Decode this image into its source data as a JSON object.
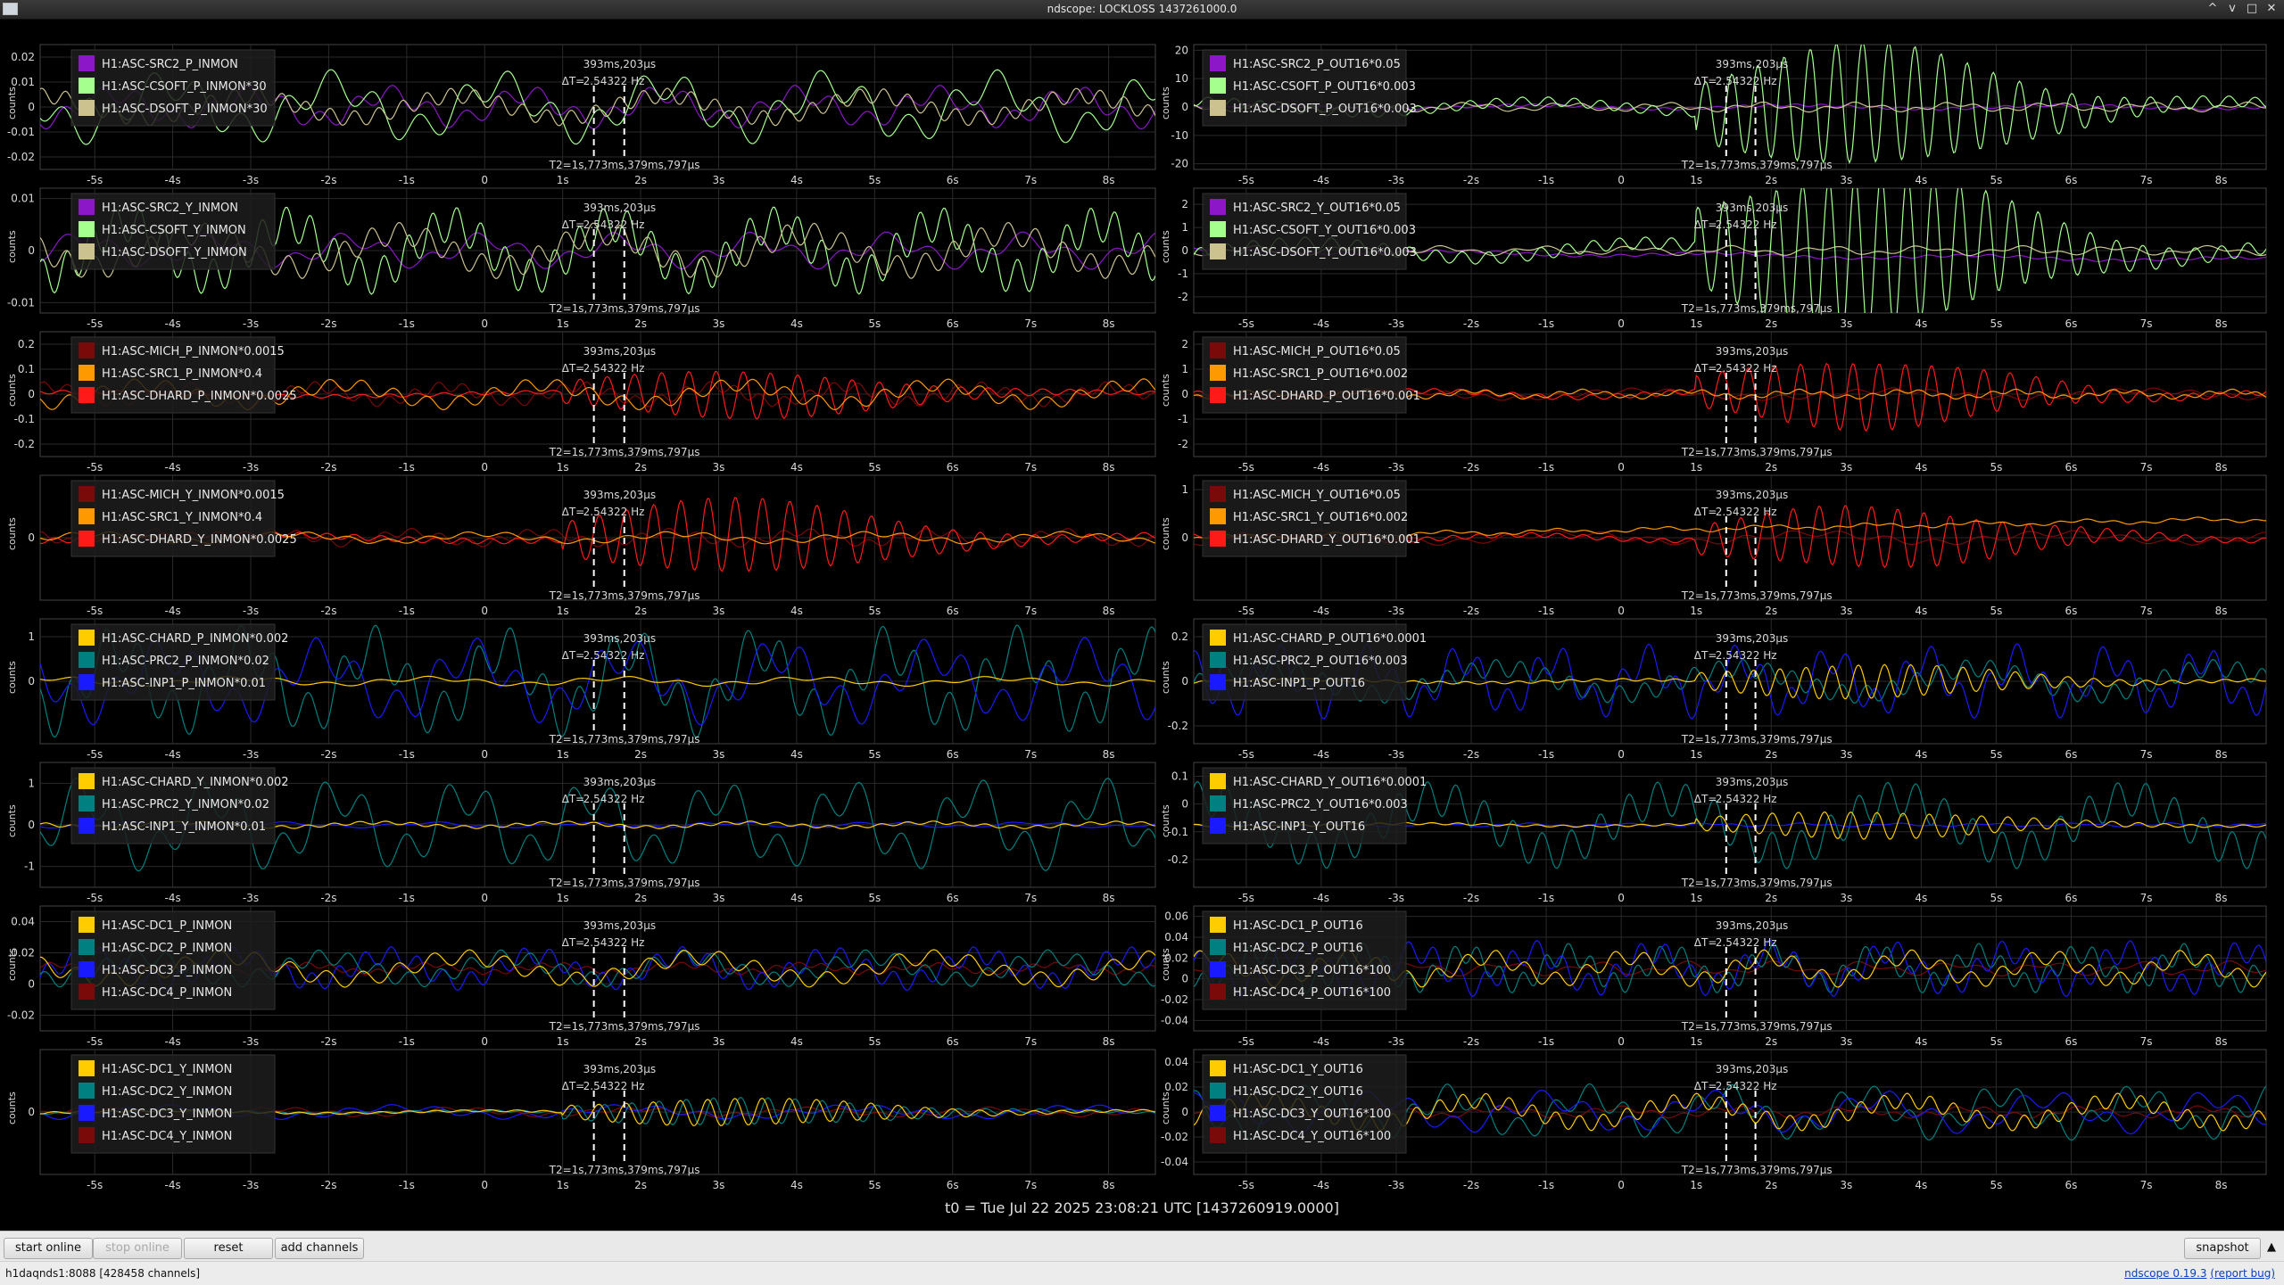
{
  "window": {
    "title": "ndscope: LOCKLOSS 1437261000.0",
    "controls": [
      "^",
      "v",
      "□",
      "✕"
    ]
  },
  "theme": {
    "grid": "#2a2a2a",
    "axis_text": "#d8d8d8",
    "legend_bg": "#1d1d1d",
    "cursor_color": "#ffffff"
  },
  "common": {
    "ylabel": "counts",
    "cursor": {
      "delta_label": "ΔT=",
      "delta_value": "393ms,203μs",
      "freq": "2.54322 Hz",
      "t2_label": "T2=1s,773ms,379ms,797μs"
    }
  },
  "plots": [
    {
      "column": "left",
      "ylim": [
        -0.025,
        0.025
      ],
      "yticks": [
        "0.02",
        "0.01",
        "0",
        "-0.01",
        "-0.02"
      ],
      "xticks": [
        "-5s",
        "-4s",
        "-3s",
        "-2s",
        "-1s",
        "0",
        "1s",
        "2s",
        "3s",
        "4s",
        "5s",
        "6s",
        "7s",
        "8s"
      ],
      "xlim": [
        -5.7,
        8.6
      ],
      "legend": [
        {
          "name": "H1:ASC-SRC2_P_INMON",
          "color": "#8b17c9"
        },
        {
          "name": "H1:ASC-CSOFT_P_INMON*30",
          "color": "#a4ff8f"
        },
        {
          "name": "H1:ASC-DSOFT_P_INMON*30",
          "color": "#cbc28f"
        }
      ],
      "series": [
        {
          "color": "#8b17c9",
          "amp": 0.35,
          "seed": 1
        },
        {
          "color": "#a4ff8f",
          "amp": 0.6,
          "seed": 2
        },
        {
          "color": "#cbc28f",
          "amp": 0.3,
          "seed": 3
        }
      ]
    },
    {
      "column": "right",
      "ylim": [
        -22,
        22
      ],
      "yticks": [
        "20",
        "10",
        "0",
        "-10",
        "-20"
      ],
      "xticks": [
        "-5s",
        "-4s",
        "-3s",
        "-2s",
        "-1s",
        "0",
        "1s",
        "2s",
        "3s",
        "4s",
        "5s",
        "6s",
        "7s",
        "8s"
      ],
      "xlim": [
        -5.7,
        8.6
      ],
      "legend": [
        {
          "name": "H1:ASC-SRC2_P_OUT16*0.05",
          "color": "#8b17c9"
        },
        {
          "name": "H1:ASC-CSOFT_P_OUT16*0.003",
          "color": "#a4ff8f"
        },
        {
          "name": "H1:ASC-DSOFT_P_OUT16*0.003",
          "color": "#cbc28f"
        }
      ],
      "series": [
        {
          "color": "#8b17c9",
          "amp": 0.05,
          "seed": 4
        },
        {
          "color": "#cbc28f",
          "amp": 0.08,
          "seed": 5
        },
        {
          "color": "#a4ff8f",
          "amp": 0.9,
          "seed": 6,
          "burst": true
        }
      ]
    },
    {
      "column": "left",
      "ylim": [
        -0.012,
        0.012
      ],
      "yticks": [
        "0.01",
        "0",
        "-0.01"
      ],
      "xticks": [
        "-5s",
        "-4s",
        "-3s",
        "-2s",
        "-1s",
        "0",
        "1s",
        "2s",
        "3s",
        "4s",
        "5s",
        "6s",
        "7s",
        "8s"
      ],
      "xlim": [
        -5.7,
        8.6
      ],
      "legend": [
        {
          "name": "H1:ASC-SRC2_Y_INMON",
          "color": "#8b17c9"
        },
        {
          "name": "H1:ASC-CSOFT_Y_INMON",
          "color": "#a4ff8f"
        },
        {
          "name": "H1:ASC-DSOFT_Y_INMON",
          "color": "#cbc28f"
        }
      ],
      "series": [
        {
          "color": "#8b17c9",
          "amp": 0.3,
          "seed": 7
        },
        {
          "color": "#a4ff8f",
          "amp": 0.7,
          "seed": 8
        },
        {
          "color": "#cbc28f",
          "amp": 0.45,
          "seed": 9
        }
      ]
    },
    {
      "column": "right",
      "ylim": [
        -2.7,
        2.7
      ],
      "yticks": [
        "2",
        "1",
        "0",
        "-1",
        "-2"
      ],
      "xticks": [
        "-5s",
        "-4s",
        "-3s",
        "-2s",
        "-1s",
        "0",
        "1s",
        "2s",
        "3s",
        "4s",
        "5s",
        "6s",
        "7s",
        "8s"
      ],
      "xlim": [
        -5.7,
        8.6
      ],
      "legend": [
        {
          "name": "H1:ASC-SRC2_Y_OUT16*0.05",
          "color": "#8b17c9"
        },
        {
          "name": "H1:ASC-CSOFT_Y_OUT16*0.003",
          "color": "#a4ff8f"
        },
        {
          "name": "H1:ASC-DSOFT_Y_OUT16*0.003",
          "color": "#cbc28f"
        }
      ],
      "series": [
        {
          "color": "#8b17c9",
          "amp": 0.05,
          "seed": 10,
          "drift": -0.15
        },
        {
          "color": "#cbc28f",
          "amp": 0.08,
          "seed": 11
        },
        {
          "color": "#a4ff8f",
          "amp": 1.2,
          "seed": 12,
          "burst": true
        }
      ]
    },
    {
      "column": "left",
      "ylim": [
        -0.25,
        0.25
      ],
      "yticks": [
        "0.2",
        "0.1",
        "0",
        "-0.1",
        "-0.2"
      ],
      "xticks": [
        "-5s",
        "-4s",
        "-3s",
        "-2s",
        "-1s",
        "0",
        "1s",
        "2s",
        "3s",
        "4s",
        "5s",
        "6s",
        "7s",
        "8s"
      ],
      "xlim": [
        -5.7,
        8.6
      ],
      "legend": [
        {
          "name": "H1:ASC-MICH_P_INMON*0.0015",
          "color": "#7a0a0a"
        },
        {
          "name": "H1:ASC-SRC1_P_INMON*0.4",
          "color": "#ff9900"
        },
        {
          "name": "H1:ASC-DHARD_P_INMON*0.0025",
          "color": "#ff1a1a"
        }
      ],
      "series": [
        {
          "color": "#7a0a0a",
          "amp": 0.2,
          "seed": 13
        },
        {
          "color": "#ff1a1a",
          "amp": 0.35,
          "seed": 14,
          "burst": true
        },
        {
          "color": "#ff9900",
          "amp": 0.25,
          "seed": 15
        }
      ]
    },
    {
      "column": "right",
      "ylim": [
        -2.5,
        2.5
      ],
      "yticks": [
        "2",
        "1",
        "0",
        "-1",
        "-2"
      ],
      "xticks": [
        "-5s",
        "-4s",
        "-3s",
        "-2s",
        "-1s",
        "0",
        "1s",
        "2s",
        "3s",
        "4s",
        "5s",
        "6s",
        "7s",
        "8s"
      ],
      "xlim": [
        -5.7,
        8.6
      ],
      "legend": [
        {
          "name": "H1:ASC-MICH_P_OUT16*0.05",
          "color": "#7a0a0a"
        },
        {
          "name": "H1:ASC-SRC1_P_OUT16*0.002",
          "color": "#ff9900"
        },
        {
          "name": "H1:ASC-DHARD_P_OUT16*0.001",
          "color": "#ff1a1a"
        }
      ],
      "series": [
        {
          "color": "#7a0a0a",
          "amp": 0.1,
          "seed": 16
        },
        {
          "color": "#ff1a1a",
          "amp": 0.5,
          "seed": 17,
          "burst": true
        },
        {
          "color": "#ff9900",
          "amp": 0.08,
          "seed": 18
        }
      ]
    },
    {
      "column": "left",
      "ylim": [
        -0.3,
        0.3
      ],
      "yticks": [
        "0"
      ],
      "xticks": [
        "-5s",
        "-4s",
        "-3s",
        "-2s",
        "-1s",
        "0",
        "1s",
        "2s",
        "3s",
        "4s",
        "5s",
        "6s",
        "7s",
        "8s"
      ],
      "xlim": [
        -5.7,
        8.6
      ],
      "legend": [
        {
          "name": "H1:ASC-MICH_Y_INMON*0.0015",
          "color": "#7a0a0a"
        },
        {
          "name": "H1:ASC-SRC1_Y_INMON*0.4",
          "color": "#ff9900"
        },
        {
          "name": "H1:ASC-DHARD_Y_INMON*0.0025",
          "color": "#ff1a1a"
        }
      ],
      "series": [
        {
          "color": "#7a0a0a",
          "amp": 0.15,
          "seed": 19
        },
        {
          "color": "#ff1a1a",
          "amp": 0.55,
          "seed": 20,
          "burst": true
        },
        {
          "color": "#ff9900",
          "amp": 0.1,
          "seed": 21
        }
      ]
    },
    {
      "column": "right",
      "ylim": [
        -1.3,
        1.3
      ],
      "yticks": [
        "1",
        "0"
      ],
      "xticks": [
        "-5s",
        "-4s",
        "-3s",
        "-2s",
        "-1s",
        "0",
        "1s",
        "2s",
        "3s",
        "4s",
        "5s",
        "6s",
        "7s",
        "8s"
      ],
      "xlim": [
        -5.7,
        8.6
      ],
      "legend": [
        {
          "name": "H1:ASC-MICH_Y_OUT16*0.05",
          "color": "#7a0a0a"
        },
        {
          "name": "H1:ASC-SRC1_Y_OUT16*0.002",
          "color": "#ff9900"
        },
        {
          "name": "H1:ASC-DHARD_Y_OUT16*0.001",
          "color": "#ff1a1a"
        }
      ],
      "series": [
        {
          "color": "#7a0a0a",
          "amp": 0.12,
          "seed": 22
        },
        {
          "color": "#ff1a1a",
          "amp": 0.45,
          "seed": 23,
          "burst": true
        },
        {
          "color": "#ff9900",
          "amp": 0.05,
          "seed": 24,
          "drift": 0.3
        }
      ]
    },
    {
      "column": "left",
      "ylim": [
        -1.4,
        1.4
      ],
      "yticks": [
        "1",
        "0"
      ],
      "xticks": [
        "-5s",
        "-4s",
        "-3s",
        "-2s",
        "-1s",
        "0",
        "1s",
        "2s",
        "3s",
        "4s",
        "5s",
        "6s",
        "7s",
        "8s"
      ],
      "xlim": [
        -5.7,
        8.6
      ],
      "legend": [
        {
          "name": "H1:ASC-CHARD_P_INMON*0.002",
          "color": "#ffcc00"
        },
        {
          "name": "H1:ASC-PRC2_P_INMON*0.02",
          "color": "#008080"
        },
        {
          "name": "H1:ASC-INP1_P_INMON*0.01",
          "color": "#1a1aff"
        }
      ],
      "series": [
        {
          "color": "#008080",
          "amp": 0.9,
          "seed": 25
        },
        {
          "color": "#1a1aff",
          "amp": 0.7,
          "seed": 26
        },
        {
          "color": "#ffcc00",
          "amp": 0.08,
          "seed": 27
        }
      ]
    },
    {
      "column": "right",
      "ylim": [
        -0.28,
        0.28
      ],
      "yticks": [
        "0.2",
        "0",
        "-0.2"
      ],
      "xticks": [
        "-5s",
        "-4s",
        "-3s",
        "-2s",
        "-1s",
        "0",
        "1s",
        "2s",
        "3s",
        "4s",
        "5s",
        "6s",
        "7s",
        "8s"
      ],
      "xlim": [
        -5.7,
        8.6
      ],
      "legend": [
        {
          "name": "H1:ASC-CHARD_P_OUT16*0.0001",
          "color": "#ffcc00"
        },
        {
          "name": "H1:ASC-PRC2_P_OUT16*0.003",
          "color": "#008080"
        },
        {
          "name": "H1:ASC-INP1_P_OUT16",
          "color": "#1a1aff"
        }
      ],
      "series": [
        {
          "color": "#008080",
          "amp": 0.35,
          "seed": 28
        },
        {
          "color": "#1a1aff",
          "amp": 0.6,
          "seed": 29
        },
        {
          "color": "#ffcc00",
          "amp": 0.25,
          "seed": 30,
          "burst": true
        }
      ]
    },
    {
      "column": "left",
      "ylim": [
        -1.5,
        1.5
      ],
      "yticks": [
        "1",
        "0",
        "-1"
      ],
      "xticks": [
        "-5s",
        "-4s",
        "-3s",
        "-2s",
        "-1s",
        "0",
        "1s",
        "2s",
        "3s",
        "4s",
        "5s",
        "6s",
        "7s",
        "8s"
      ],
      "xlim": [
        -5.7,
        8.6
      ],
      "legend": [
        {
          "name": "H1:ASC-CHARD_Y_INMON*0.002",
          "color": "#ffcc00"
        },
        {
          "name": "H1:ASC-PRC2_Y_INMON*0.02",
          "color": "#008080"
        },
        {
          "name": "H1:ASC-INP1_Y_INMON*0.01",
          "color": "#1a1aff"
        }
      ],
      "series": [
        {
          "color": "#008080",
          "amp": 0.8,
          "seed": 31
        },
        {
          "color": "#1a1aff",
          "amp": 0.05,
          "seed": 32
        },
        {
          "color": "#ffcc00",
          "amp": 0.06,
          "seed": 33
        }
      ]
    },
    {
      "column": "right",
      "ylim": [
        -0.3,
        0.15
      ],
      "yticks": [
        "0.1",
        "0",
        "-0.1",
        "-0.2"
      ],
      "xticks": [
        "-5s",
        "-4s",
        "-3s",
        "-2s",
        "-1s",
        "0",
        "1s",
        "2s",
        "3s",
        "4s",
        "5s",
        "6s",
        "7s",
        "8s"
      ],
      "xlim": [
        -5.7,
        8.6
      ],
      "legend": [
        {
          "name": "H1:ASC-CHARD_Y_OUT16*0.0001",
          "color": "#ffcc00"
        },
        {
          "name": "H1:ASC-PRC2_Y_OUT16*0.003",
          "color": "#008080"
        },
        {
          "name": "H1:ASC-INP1_Y_OUT16",
          "color": "#1a1aff"
        }
      ],
      "series": [
        {
          "color": "#008080",
          "amp": 0.7,
          "seed": 34
        },
        {
          "color": "#1a1aff",
          "amp": 0.03,
          "seed": 35
        },
        {
          "color": "#ffcc00",
          "amp": 0.2,
          "seed": 36,
          "burst": true
        }
      ]
    },
    {
      "column": "left",
      "ylim": [
        -0.03,
        0.05
      ],
      "yticks": [
        "0.04",
        "0.02",
        "0",
        "-0.02"
      ],
      "xticks": [
        "-5s",
        "-4s",
        "-3s",
        "-2s",
        "-1s",
        "0",
        "1s",
        "2s",
        "3s",
        "4s",
        "5s",
        "6s",
        "7s",
        "8s"
      ],
      "xlim": [
        -5.7,
        8.6
      ],
      "legend": [
        {
          "name": "H1:ASC-DC1_P_INMON",
          "color": "#ffcc00"
        },
        {
          "name": "H1:ASC-DC2_P_INMON",
          "color": "#008080"
        },
        {
          "name": "H1:ASC-DC3_P_INMON",
          "color": "#1a1aff"
        },
        {
          "name": "H1:ASC-DC4_P_INMON",
          "color": "#7a0a0a"
        }
      ],
      "series": [
        {
          "color": "#7a0a0a",
          "amp": 0.1,
          "seed": 37
        },
        {
          "color": "#1a1aff",
          "amp": 0.35,
          "seed": 38
        },
        {
          "color": "#008080",
          "amp": 0.3,
          "seed": 39
        },
        {
          "color": "#ffcc00",
          "amp": 0.3,
          "seed": 40
        }
      ]
    },
    {
      "column": "right",
      "ylim": [
        -0.05,
        0.07
      ],
      "yticks": [
        "0.06",
        "0.04",
        "0.02",
        "0",
        "-0.02",
        "-0.04"
      ],
      "xticks": [
        "-5s",
        "-4s",
        "-3s",
        "-2s",
        "-1s",
        "0",
        "1s",
        "2s",
        "3s",
        "4s",
        "5s",
        "6s",
        "7s",
        "8s"
      ],
      "xlim": [
        -5.7,
        8.6
      ],
      "legend": [
        {
          "name": "H1:ASC-DC1_P_OUT16",
          "color": "#ffcc00"
        },
        {
          "name": "H1:ASC-DC2_P_OUT16",
          "color": "#008080"
        },
        {
          "name": "H1:ASC-DC3_P_OUT16*100",
          "color": "#1a1aff"
        },
        {
          "name": "H1:ASC-DC4_P_OUT16*100",
          "color": "#7a0a0a"
        }
      ],
      "series": [
        {
          "color": "#7a0a0a",
          "amp": 0.12,
          "seed": 41
        },
        {
          "color": "#008080",
          "amp": 0.4,
          "seed": 42
        },
        {
          "color": "#1a1aff",
          "amp": 0.45,
          "seed": 43
        },
        {
          "color": "#ffcc00",
          "amp": 0.3,
          "seed": 44
        }
      ]
    },
    {
      "column": "left",
      "ylim": [
        -0.11,
        0.11
      ],
      "yticks": [
        "0"
      ],
      "xticks": [
        "-5s",
        "-4s",
        "-3s",
        "-2s",
        "-1s",
        "0",
        "1s",
        "2s",
        "3s",
        "4s",
        "5s",
        "6s",
        "7s",
        "8s"
      ],
      "xlim": [
        -5.7,
        8.6
      ],
      "legend": [
        {
          "name": "H1:ASC-DC1_Y_INMON",
          "color": "#ffcc00"
        },
        {
          "name": "H1:ASC-DC2_Y_INMON",
          "color": "#008080"
        },
        {
          "name": "H1:ASC-DC3_Y_INMON",
          "color": "#1a1aff"
        },
        {
          "name": "H1:ASC-DC4_Y_INMON",
          "color": "#7a0a0a"
        }
      ],
      "series": [
        {
          "color": "#7a0a0a",
          "amp": 0.08,
          "seed": 45
        },
        {
          "color": "#1a1aff",
          "amp": 0.12,
          "seed": 46
        },
        {
          "color": "#008080",
          "amp": 0.2,
          "seed": 47,
          "burst": true
        },
        {
          "color": "#ffcc00",
          "amp": 0.2,
          "seed": 48,
          "burst": true
        }
      ]
    },
    {
      "column": "right",
      "ylim": [
        -0.05,
        0.05
      ],
      "yticks": [
        "0.04",
        "0.02",
        "0",
        "-0.02",
        "-0.04"
      ],
      "xticks": [
        "-5s",
        "-4s",
        "-3s",
        "-2s",
        "-1s",
        "0",
        "1s",
        "2s",
        "3s",
        "4s",
        "5s",
        "6s",
        "7s",
        "8s"
      ],
      "xlim": [
        -5.7,
        8.6
      ],
      "legend": [
        {
          "name": "H1:ASC-DC1_Y_OUT16",
          "color": "#ffcc00"
        },
        {
          "name": "H1:ASC-DC2_Y_OUT16",
          "color": "#008080"
        },
        {
          "name": "H1:ASC-DC3_Y_OUT16*100",
          "color": "#1a1aff"
        },
        {
          "name": "H1:ASC-DC4_Y_OUT16*100",
          "color": "#7a0a0a"
        }
      ],
      "series": [
        {
          "color": "#7a0a0a",
          "amp": 0.1,
          "seed": 49
        },
        {
          "color": "#008080",
          "amp": 0.45,
          "seed": 50
        },
        {
          "color": "#1a1aff",
          "amp": 0.35,
          "seed": 51
        },
        {
          "color": "#ffcc00",
          "amp": 0.3,
          "seed": 52
        }
      ]
    }
  ],
  "t0_label": "t0 = Tue Jul 22 2025 23:08:21 UTC [1437260919.0000]",
  "toolbar": {
    "start_online": "start online",
    "stop_online": "stop online",
    "reset": "reset",
    "add_channels": "add channels",
    "snapshot": "snapshot",
    "expand": "▲"
  },
  "status": {
    "server": "h1daqnds1:8088  [428458 channels]",
    "version_link": "ndscope 0.19.3",
    "report_bug": "(report bug)"
  }
}
